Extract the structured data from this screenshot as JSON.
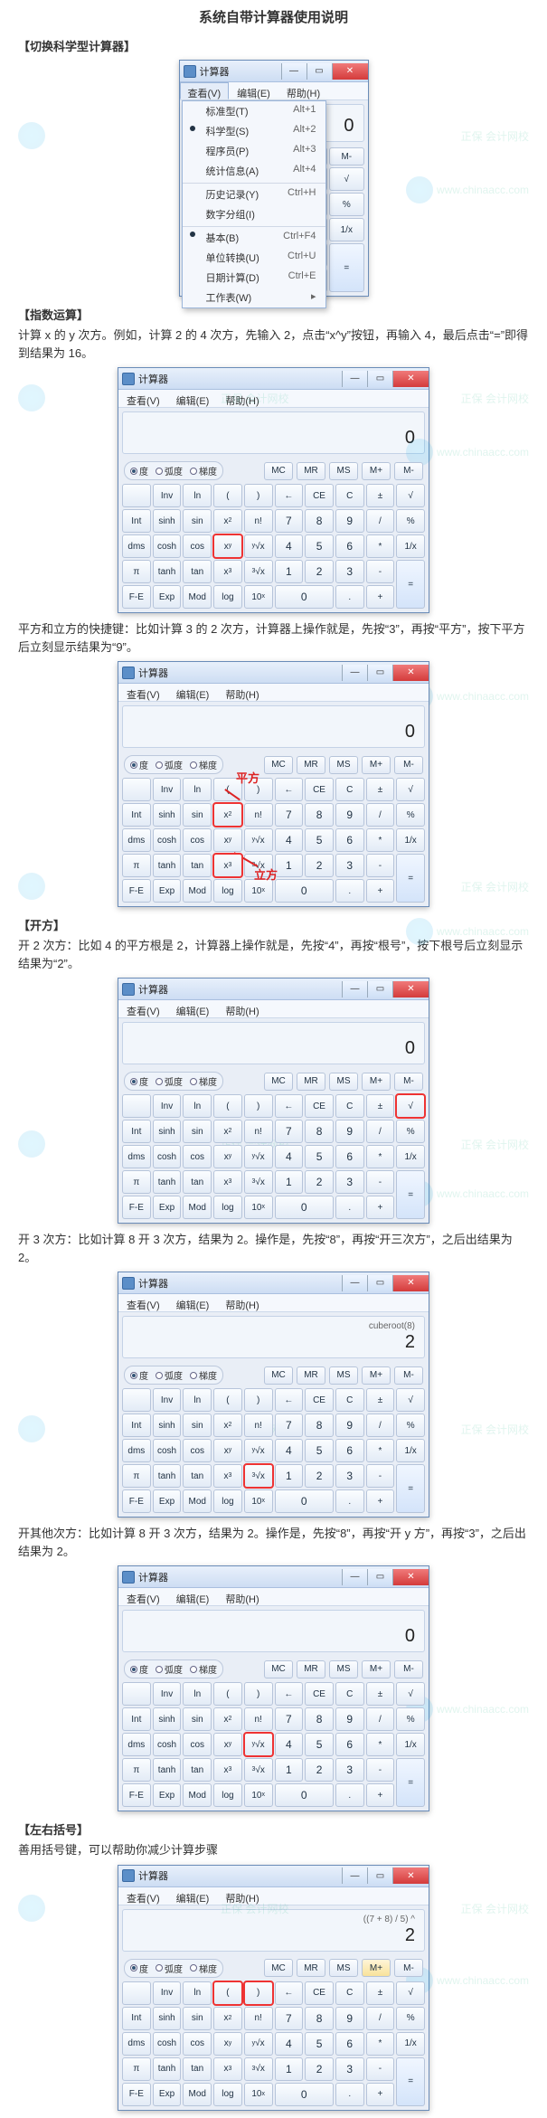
{
  "title": "系统自带计算器使用说明",
  "sections": {
    "switch": "【切换科学型计算器】",
    "exp": "【指数运算】",
    "root": "【开方】",
    "paren": "【左右括号】"
  },
  "text": {
    "exp1": "计算 x 的 y 次方。例如，计算 2 的 4 次方，先输入 2，点击“x^y”按钮，再输入 4，最后点击“=”即得到结果为 16。",
    "exp2": "平方和立方的快捷键：比如计算 3 的 2 次方，计算器上操作就是，先按“3”，再按“平方”，按下平方后立刻显示结果为“9”。",
    "root1": "开 2 次方：比如 4 的平方根是 2，计算器上操作就是，先按“4”，再按“根号”，按下根号后立刻显示结果为“2”。",
    "root2": "开 3 次方：比如计算 8 开 3 次方，结果为 2。操作是，先按“8”，再按“开三次方”，之后出结果为 2。",
    "root3": "开其他次方：比如计算 8 开 3 次方，结果为 2。操作是，先按“8”，再按“开 y 方”，再按“3”，之后出结果为 2。",
    "paren1": "善用括号键，可以帮助你减少计算步骤"
  },
  "calc": {
    "app_title": "计算器",
    "menus": {
      "view": "查看(V)",
      "edit": "编辑(E)",
      "help": "帮助(H)"
    },
    "view_menu": [
      {
        "label": "标准型(T)",
        "sc": "Alt+1"
      },
      {
        "label": "科学型(S)",
        "sc": "Alt+2",
        "sel": true
      },
      {
        "label": "程序员(P)",
        "sc": "Alt+3"
      },
      {
        "label": "统计信息(A)",
        "sc": "Alt+4"
      },
      {
        "label": "历史记录(Y)",
        "sc": "Ctrl+H",
        "sep": true
      },
      {
        "label": "数字分组(I)",
        "sc": ""
      },
      {
        "label": "基本(B)",
        "sc": "Ctrl+F4",
        "sep": true,
        "sel": true
      },
      {
        "label": "单位转换(U)",
        "sc": "Ctrl+U"
      },
      {
        "label": "日期计算(D)",
        "sc": "Ctrl+E"
      },
      {
        "label": "工作表(W)",
        "sc": "",
        "arrow": true
      }
    ],
    "angle": {
      "deg": "度",
      "rad": "弧度",
      "grad": "梯度"
    },
    "mem": [
      "MC",
      "MR",
      "MS",
      "M+",
      "M-"
    ],
    "rowA": [
      "",
      "Inv",
      "ln",
      "(",
      ")",
      "←",
      "CE",
      "C",
      "±",
      "√"
    ],
    "rowB": [
      "Int",
      "sinh",
      "sin",
      "x²",
      "n!",
      "7",
      "8",
      "9",
      "/",
      "%"
    ],
    "rowC": [
      "dms",
      "cosh",
      "cos",
      "xʸ",
      "ʸ√x",
      "4",
      "5",
      "6",
      "*",
      "1/x"
    ],
    "rowD": [
      "π",
      "tanh",
      "tan",
      "x³",
      "³√x",
      "1",
      "2",
      "3",
      "-",
      "="
    ],
    "rowE": [
      "F-E",
      "Exp",
      "Mod",
      "log",
      "10ˣ",
      "0",
      "",
      ".",
      "+",
      ""
    ],
    "std_mem": [
      "MC",
      "MR",
      "MS",
      "M+",
      "M-"
    ],
    "std_rows": [
      [
        "←",
        "CE",
        "C",
        "±",
        "√"
      ],
      [
        "7",
        "8",
        "9",
        "/",
        "%"
      ],
      [
        "4",
        "5",
        "6",
        "*",
        "1/x"
      ],
      [
        "1",
        "2",
        "3",
        "-",
        "="
      ],
      [
        "0",
        "",
        ".",
        "+",
        ""
      ]
    ],
    "displays": {
      "zero": "0",
      "cbrt_upper": "cuberoot(8)",
      "cbrt_main": "2",
      "paren_upper": "((7 + 8) / 5) ^",
      "paren_main": "2"
    },
    "annot": {
      "sq": "平方",
      "cube": "立方"
    }
  },
  "watermark": {
    "brand": "正保 会计网校",
    "url": "www.chinaacc.com"
  }
}
